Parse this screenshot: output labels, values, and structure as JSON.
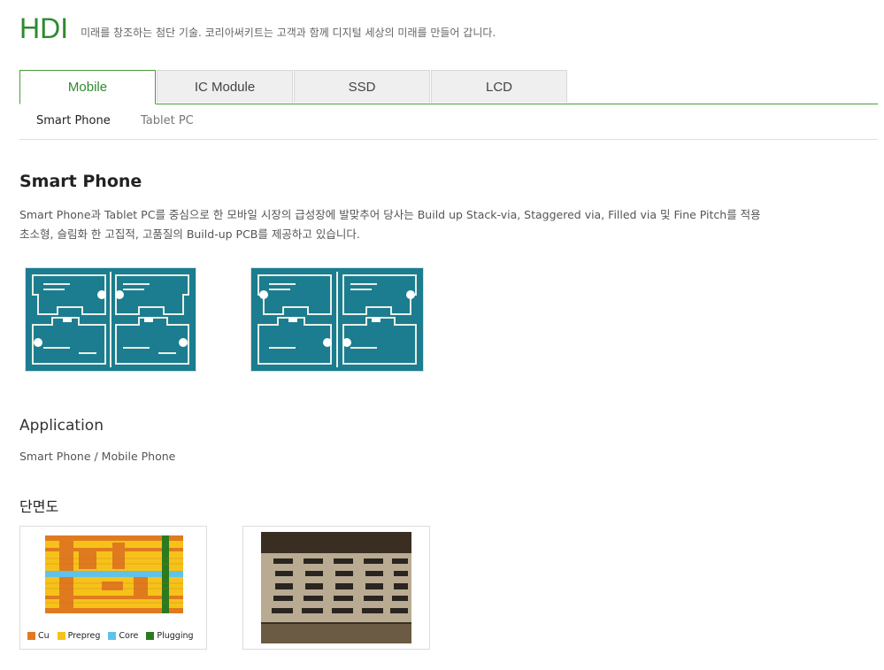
{
  "header": {
    "title": "HDI",
    "tagline": "미래를 창조하는 첨단 기술. 코리아써키트는 고객과 함께 디지털 세상의 미래를 만들어 갑니다."
  },
  "tabs": [
    {
      "label": "Mobile"
    },
    {
      "label": "IC Module"
    },
    {
      "label": "SSD"
    },
    {
      "label": "LCD"
    }
  ],
  "subtabs": [
    {
      "label": "Smart Phone"
    },
    {
      "label": "Tablet PC"
    }
  ],
  "section": {
    "title": "Smart Phone",
    "desc_line1": "Smart Phone과 Tablet PC를 중심으로 한 모바일 시장의 급성장에 발맞추어 당사는 Build up Stack-via, Staggered via, Filled via 및 Fine Pitch를 적용",
    "desc_line2": "초소형, 슬림화 한 고집적, 고품질의 Build-up PCB를 제공하고 있습니다."
  },
  "application": {
    "title": "Application",
    "text": "Smart Phone / Mobile Phone"
  },
  "cross_section": {
    "title": "단면도",
    "legend": [
      {
        "label": "Cu",
        "color": "#e07a1f"
      },
      {
        "label": "Prepreg",
        "color": "#f6c21a"
      },
      {
        "label": "Core",
        "color": "#5fc2e8"
      },
      {
        "label": "Plugging",
        "color": "#2c7a1e"
      }
    ]
  },
  "colors": {
    "accent": "#2e8b2e",
    "pcb_board": "#1b7d8f"
  }
}
